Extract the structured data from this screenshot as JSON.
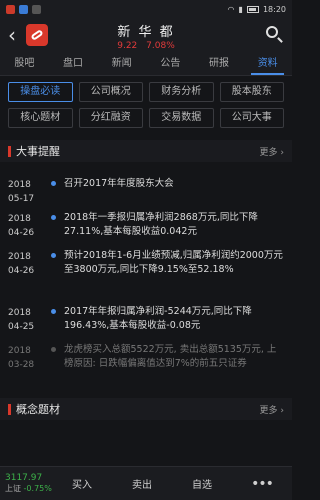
{
  "status": {
    "left_icons": "notification-icons",
    "time": "18:20"
  },
  "header": {
    "stock_name": "新 华 都",
    "price": "9.22",
    "change_pct": "7.08%"
  },
  "tabs": [
    {
      "label": "股吧"
    },
    {
      "label": "盘口"
    },
    {
      "label": "新闻"
    },
    {
      "label": "公告"
    },
    {
      "label": "研报"
    },
    {
      "label": "资料",
      "active": true
    }
  ],
  "subtabs": [
    {
      "label": "操盘必读",
      "active": true
    },
    {
      "label": "公司概况"
    },
    {
      "label": "财务分析"
    },
    {
      "label": "股本股东"
    },
    {
      "label": "核心题材"
    },
    {
      "label": "分红融资"
    },
    {
      "label": "交易数据"
    },
    {
      "label": "公司大事"
    }
  ],
  "section_events": {
    "title": "大事提醒",
    "more": "更多"
  },
  "events": [
    {
      "year": "2018",
      "md": "05-17",
      "text": "召开2017年年度股东大会"
    },
    {
      "year": "2018",
      "md": "04-26",
      "text": "2018年一季报归属净利润2868万元,同比下降27.11%,基本每股收益0.042元"
    },
    {
      "year": "2018",
      "md": "04-26",
      "text": "预计2018年1-6月业绩预减,归属净利润约2000万元至3800万元,同比下降9.15%至52.18%"
    },
    {
      "year": "2018",
      "md": "04-25",
      "text": "2017年年报归属净利润-5244万元,同比下降196.43%,基本每股收益-0.08元"
    },
    {
      "year": "2018",
      "md": "03-28",
      "text": "龙虎榜买入总额5522万元, 卖出总额5135万元, 上榜原因: 日跌幅偏离值达到7%的前五只证券",
      "dim": true
    }
  ],
  "section_concepts": {
    "title": "概念题材",
    "more": "更多"
  },
  "bottom": {
    "index_value": "3117.97",
    "index_change": "-0.75%",
    "index_name": "上证",
    "buy": "买入",
    "sell": "卖出",
    "watch": "自选",
    "more": "•••"
  }
}
